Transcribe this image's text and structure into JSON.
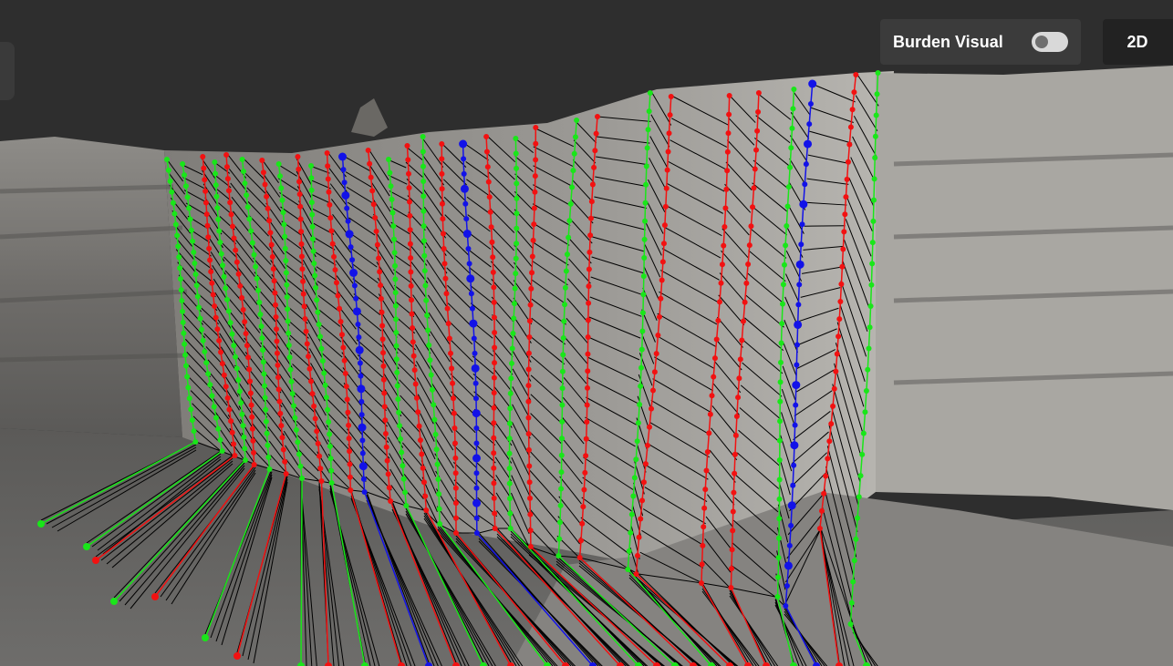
{
  "controls": {
    "burden_visual_label": "Burden Visual",
    "burden_visual_enabled": false,
    "view_mode_label": "2D"
  },
  "colors": {
    "background": "#2e2e2e",
    "panel": "#3b3b3b",
    "button_2d": "#222222",
    "trace_green": "#19e619",
    "trace_red": "#f21111",
    "trace_blue": "#1212e8",
    "burden_line": "#000000"
  }
}
